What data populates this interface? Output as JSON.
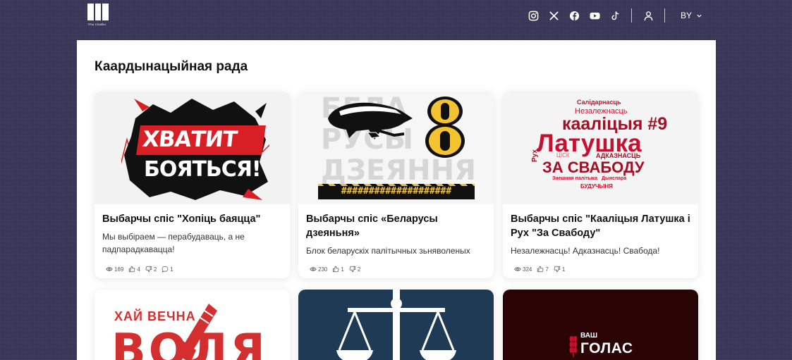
{
  "header": {
    "logo_text": "ТРЫ СЛАЙЫ",
    "social_icons": [
      "instagram-icon",
      "x-icon",
      "facebook-icon",
      "youtube-icon",
      "tiktok-icon"
    ],
    "user_icon": "user-icon",
    "language": "BY"
  },
  "section": {
    "title": "Каардынацыйная рада"
  },
  "cards": [
    {
      "title": "Выбарчы спіс \"Хопіць баяцца\"",
      "description": "Мы выбіраем — перабудаваць, а не падпарадкавацца!",
      "image_text": [
        "ХВАТИТ",
        "БОЯТЬСЯ!"
      ],
      "views": "169",
      "likes": "4",
      "dislikes": "2",
      "comments": "1"
    },
    {
      "title": "Выбарчы спіс «Беларусы дзеяньня»",
      "description": "Блок беларускіх палітычных зьняволеных",
      "image_text": [
        "БЕЛА",
        "РУСЫ",
        "ДЗЕЯННЯ",
        "####################"
      ],
      "views": "230",
      "likes": "1",
      "dislikes": "2"
    },
    {
      "title": "Выбарчы спіс \"Кааліцыя Латушка і Рух \"За Свабоду\"",
      "description": "Незалежнасць! Адказнасць! Свабода!",
      "image_words": [
        "Салідарнасць",
        "Незалежнасць",
        "кааліцыя #9",
        "Латушка",
        "Рух",
        "ЦІСК",
        "АДКАЗНАСЦЬ",
        "ЗА СВАБОДУ",
        "Знешняя палітыка",
        "Дыяспара",
        "БУДУЧЫНЯ"
      ],
      "views": "324",
      "likes": "7",
      "dislikes": "1"
    },
    {
      "image_text": [
        "ХАЙ ВЕЧНА",
        "ВОЛЯ"
      ]
    },
    {
      "image_icon": "scales-icon"
    },
    {
      "image_text": [
        "ВАШ",
        "ГОЛАС"
      ]
    }
  ],
  "colors": {
    "background": "#3a3658",
    "accent_red": "#c8102e",
    "yellow": "#f4c430"
  }
}
